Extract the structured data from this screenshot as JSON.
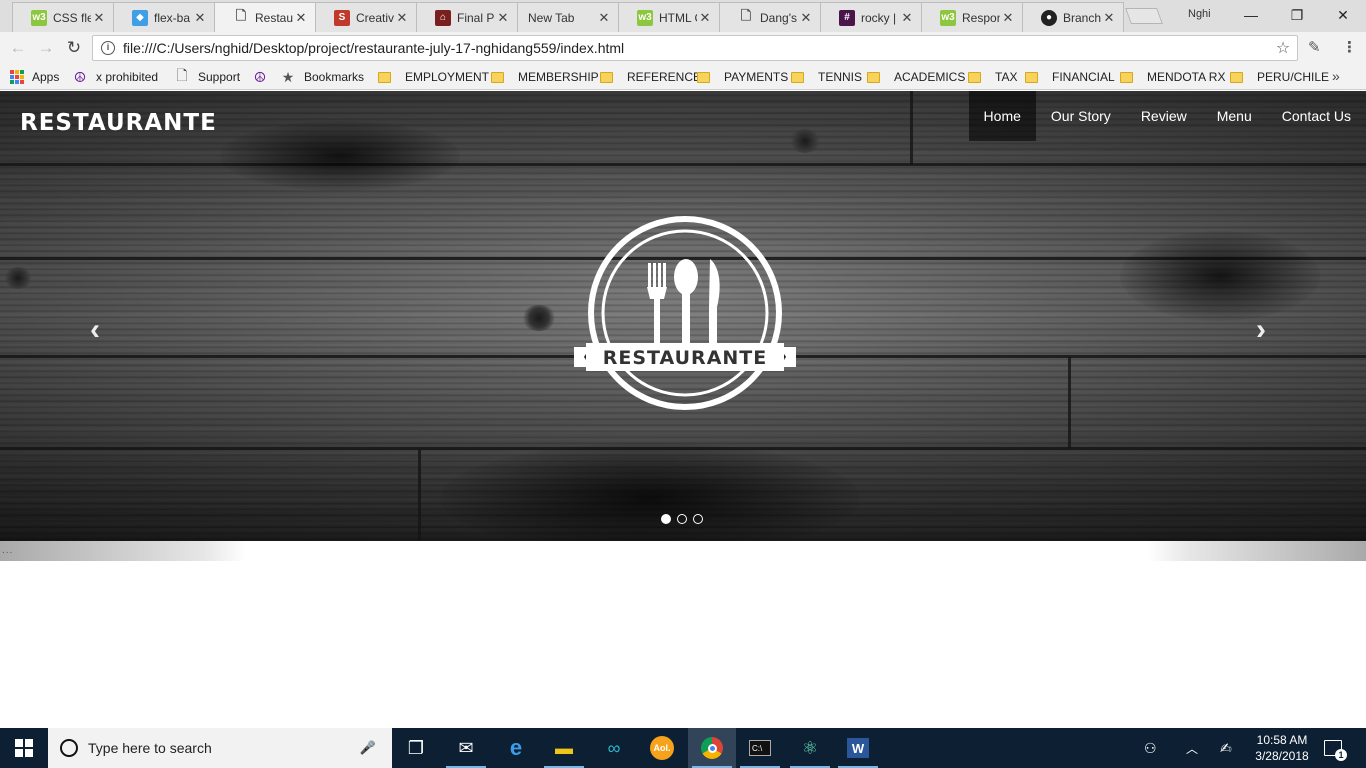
{
  "browser": {
    "tabs": [
      {
        "title": "CSS fle",
        "favicon": "w3schools-icon",
        "color": "#8dc63f",
        "glyph": "w3"
      },
      {
        "title": "flex-ba",
        "favicon": "bird-icon",
        "color": "#3e9fe6",
        "glyph": "🐦"
      },
      {
        "title": "Restaur",
        "favicon": "page-icon",
        "color": "#ffffff",
        "glyph": "🗋",
        "active": true
      },
      {
        "title": "Creative",
        "favicon": "s-icon",
        "color": "#c0392b",
        "glyph": "S"
      },
      {
        "title": "Final Pr",
        "favicon": "house-icon",
        "color": "#7a1f1f",
        "glyph": "⌂"
      },
      {
        "title": "New Tab",
        "favicon": "none",
        "color": "",
        "glyph": ""
      },
      {
        "title": "HTML C",
        "favicon": "w3schools-icon",
        "color": "#8dc63f",
        "glyph": "w3"
      },
      {
        "title": "Dang's",
        "favicon": "page-icon",
        "color": "#ffffff",
        "glyph": "🗋"
      },
      {
        "title": "rocky |",
        "favicon": "slack-icon",
        "color": "#4a154b",
        "glyph": "#"
      },
      {
        "title": "Respon",
        "favicon": "w3schools-icon",
        "color": "#8dc63f",
        "glyph": "w3"
      },
      {
        "title": "Branche",
        "favicon": "github-icon",
        "color": "#222222",
        "glyph": "●"
      }
    ],
    "profile_name": "Nghi",
    "window_controls": {
      "minimize": "—",
      "maximize": "❐",
      "close": "✕"
    },
    "url": "file:///C:/Users/nghid/Desktop/project/restaurante-july-17-nghidang559/index.html",
    "bookmarks": [
      {
        "label": "Apps",
        "icon": "apps-grid-icon"
      },
      {
        "label": "x prohibited",
        "icon": "peace-icon"
      },
      {
        "label": "Support",
        "icon": "page-icon"
      },
      {
        "label": "",
        "icon": "peace-icon"
      },
      {
        "label": "Bookmarks",
        "icon": "star-icon"
      },
      {
        "label": "EMPLOYMENT",
        "icon": "folder-icon"
      },
      {
        "label": "MEMBERSHIP",
        "icon": "folder-icon"
      },
      {
        "label": "REFERENCE",
        "icon": "folder-icon"
      },
      {
        "label": "PAYMENTS",
        "icon": "folder-icon"
      },
      {
        "label": "TENNIS",
        "icon": "folder-icon"
      },
      {
        "label": "ACADEMICS",
        "icon": "folder-icon"
      },
      {
        "label": "TAX",
        "icon": "folder-icon"
      },
      {
        "label": "FINANCIAL",
        "icon": "folder-icon"
      },
      {
        "label": "MENDOTA RX",
        "icon": "folder-icon"
      },
      {
        "label": "PERU/CHILE",
        "icon": "folder-icon"
      }
    ],
    "more_bookmarks": "»"
  },
  "site": {
    "logo": "RESTAURANTE",
    "emblem_text": "RESTAURANTE",
    "nav": [
      "Home",
      "Our Story",
      "Review",
      "Menu",
      "Contact Us"
    ],
    "active_nav": "Home",
    "carousel": {
      "prev": "‹",
      "next": "›",
      "slides": 3,
      "active_slide": 1
    },
    "strip_text": "..."
  },
  "taskbar": {
    "search_placeholder": "Type here to search",
    "time": "10:58 AM",
    "date": "3/28/2018",
    "notification_count": "1",
    "accent": "#0d2033"
  }
}
